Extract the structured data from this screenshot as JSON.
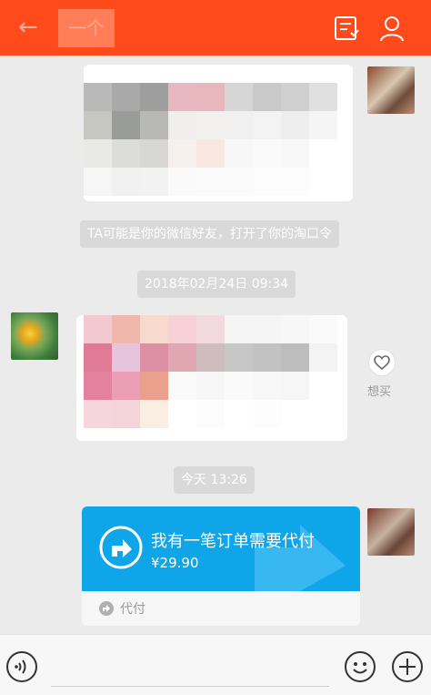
{
  "header": {
    "back_icon": "arrow-left-icon",
    "title": "一个",
    "icons": [
      "order-list-icon",
      "profile-icon"
    ],
    "bg_color": "#ff4a1c"
  },
  "messages": {
    "notice": "TA可能是你的微信好友，打开了你的淘口令",
    "time1": "2018年02月24日 09:34",
    "like_label": "想买",
    "time2": "今天  13:26",
    "payment": {
      "title": "我有一笔订单需要代付",
      "amount": "¥29.90",
      "footer": "代付",
      "color": "#0ea5e9"
    }
  },
  "input": {
    "left_icon": "voice-icon",
    "right_icons": [
      "emoji-icon",
      "plus-icon"
    ]
  }
}
